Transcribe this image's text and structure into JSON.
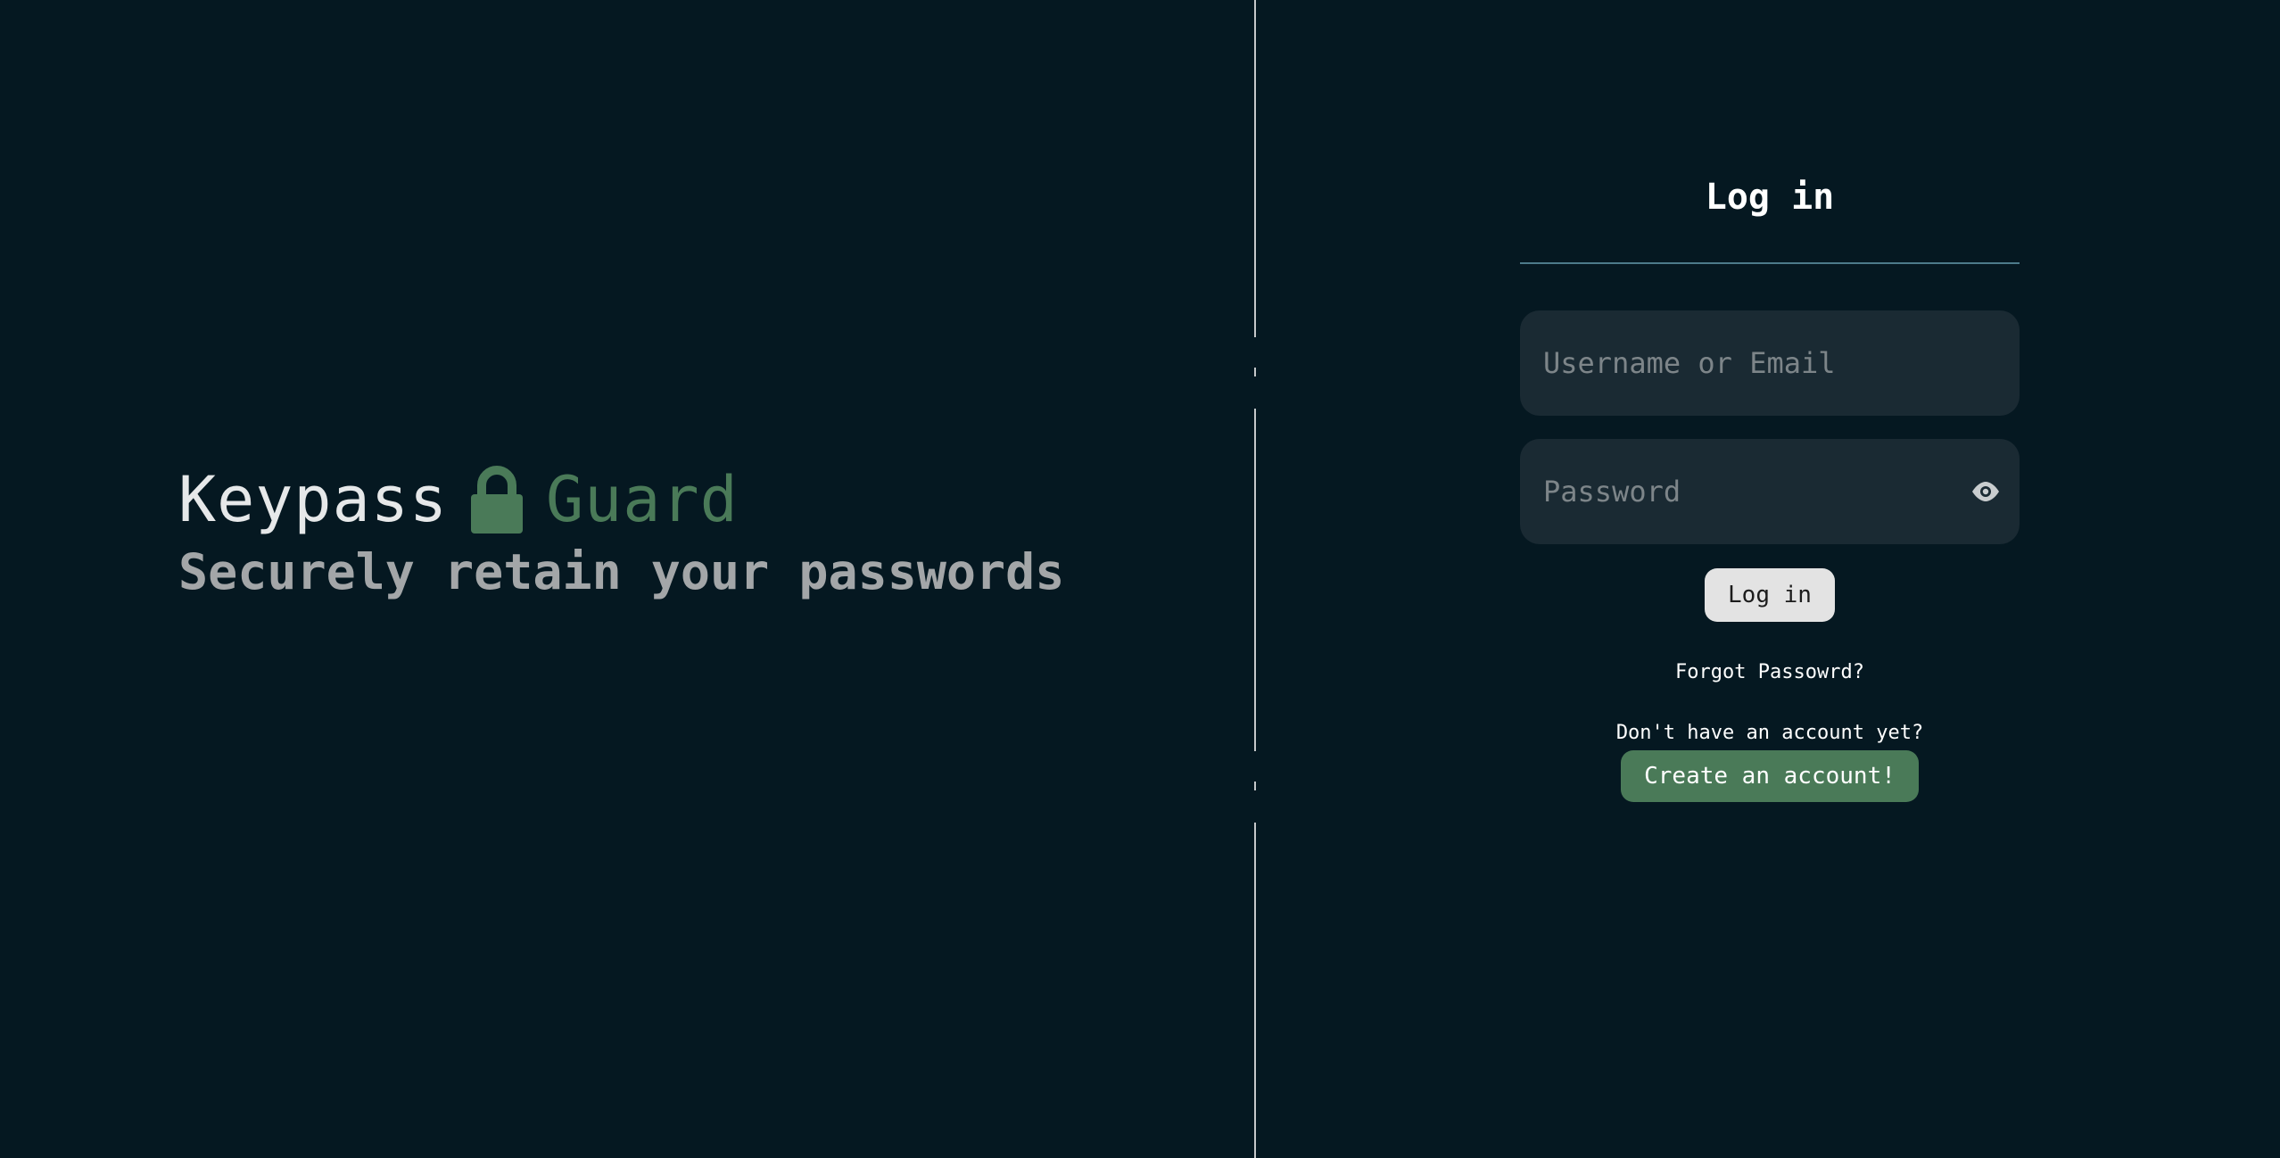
{
  "brand": {
    "name": "Keypass",
    "accent": "Guard",
    "tagline": "Securely retain your passwords",
    "icon": "lock-icon",
    "accent_color": "#4a7a58"
  },
  "login": {
    "title": "Log in",
    "username_placeholder": "Username or Email",
    "password_placeholder": "Password",
    "toggle_icon": "eye-icon",
    "submit_label": "Log in",
    "forgot_label": "Forgot Passowrd?",
    "no_account_text": "Don't have an account yet?",
    "create_label": "Create an account!"
  },
  "colors": {
    "background": "#051821",
    "field_background": "#1a2a33",
    "primary_button": "#e3e3e3",
    "create_button": "#4a7a58",
    "rule": "#4d7a8a"
  }
}
